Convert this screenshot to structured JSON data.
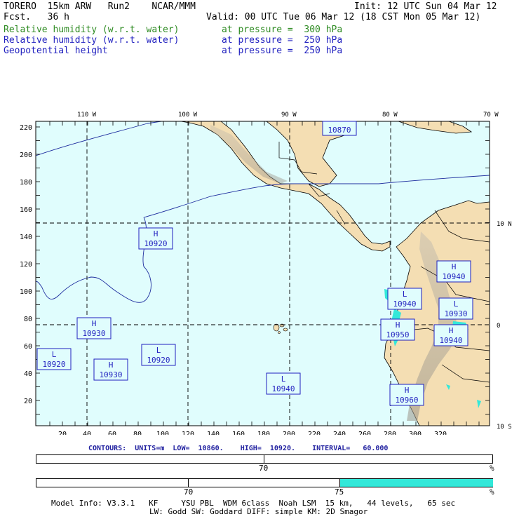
{
  "header": {
    "model": "TORERO  15km ARW   Run2    NCAR/MMM",
    "init": "Init: 12 UTC Sun 04 Mar 12",
    "fcst": "Fcst.   36 h",
    "valid": "Valid: 00 UTC Tue 06 Mar 12 (18 CST Mon 05 Mar 12)",
    "fields": [
      {
        "name": "Relative humidity (w.r.t. water)",
        "level": "at pressure =  300 hPa",
        "color": "#2e8b22"
      },
      {
        "name": "Relative humidity (w.r.t. water)",
        "level": "at pressure =  250 hPa",
        "color": "#1f1fbf"
      },
      {
        "name": "Geopotential height",
        "level": "at pressure =  250 hPa",
        "color": "#1f1fbf"
      }
    ]
  },
  "map": {
    "ocean_color": "#e0fdfd",
    "land_color": "#f4deb3",
    "lon_labels": [
      "110 W",
      "100 W",
      "90 W",
      "80 W",
      "70 W"
    ],
    "lat_labels": [
      "10 N",
      "0",
      "10 S"
    ],
    "y_ticks": [
      "220",
      "200",
      "180",
      "160",
      "140",
      "120",
      "100",
      "80",
      "60",
      "40",
      "20"
    ],
    "x_ticks": [
      "20",
      "40",
      "60",
      "80",
      "100",
      "120",
      "140",
      "160",
      "180",
      "200",
      "220",
      "240",
      "260",
      "280",
      "300",
      "320"
    ],
    "centers": [
      {
        "type": "H",
        "value": "10920"
      },
      {
        "type": "H",
        "value": "10930"
      },
      {
        "type": "H",
        "value": "10930"
      },
      {
        "type": "L",
        "value": "10920"
      },
      {
        "type": "L",
        "value": "10920"
      },
      {
        "type": "L",
        "value": "10940"
      },
      {
        "type": "L",
        "value": "10940"
      },
      {
        "type": "H",
        "value": "10950"
      },
      {
        "type": "H",
        "value": "10940"
      },
      {
        "type": "L",
        "value": "10930"
      },
      {
        "type": "H",
        "value": "10940"
      },
      {
        "type": "H",
        "value": "10960"
      },
      {
        "type": "",
        "value": "10870"
      }
    ]
  },
  "contours": "CONTOURS:  UNITS=m  LOW=  10860.    HIGH=  10920.    INTERVAL=   60.000",
  "scale1": {
    "label": "70",
    "unit": "%"
  },
  "scale2": {
    "label_a": "70",
    "label_b": "75",
    "unit": "%",
    "fill_color": "#33e8d9"
  },
  "footer": {
    "line1": "Model Info: V3.3.1   KF     YSU PBL  WDM 6class  Noah LSM  15 km,   44 levels,   65 sec",
    "line2": "LW: Godd SW: Goddard DIFF: simple KM: 2D Smagor"
  }
}
